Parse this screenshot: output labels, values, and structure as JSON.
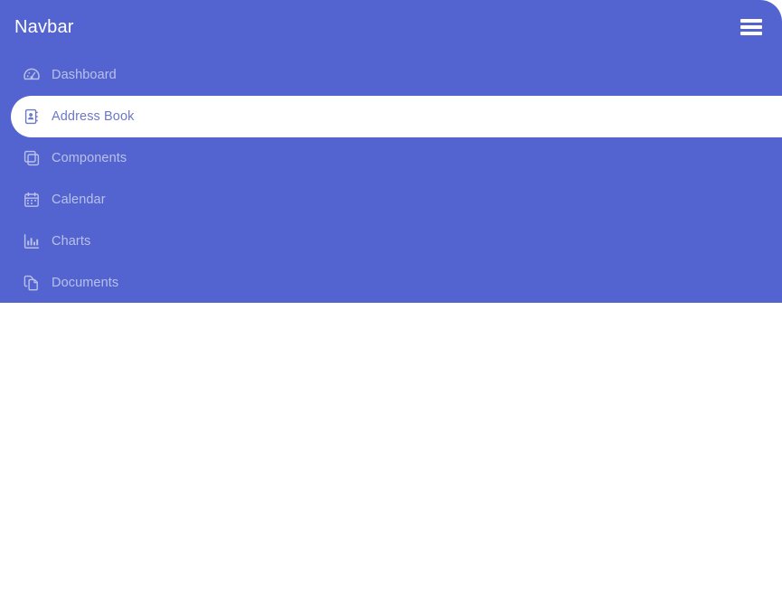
{
  "theme": {
    "panel_bg": "#5364d0",
    "active_bg": "#ffffff",
    "active_text": "#6b78c8",
    "inactive_text": "#b9c1e8",
    "title_text": "#ffffff"
  },
  "header": {
    "title": "Navbar",
    "menu_toggle_icon": "hamburger-icon"
  },
  "sidebar": {
    "items": [
      {
        "label": "Dashboard",
        "icon": "tachometer-icon",
        "active": false
      },
      {
        "label": "Address Book",
        "icon": "address-book-icon",
        "active": true
      },
      {
        "label": "Components",
        "icon": "clone-icon",
        "active": false
      },
      {
        "label": "Calendar",
        "icon": "calendar-icon",
        "active": false
      },
      {
        "label": "Charts",
        "icon": "bar-chart-icon",
        "active": false
      },
      {
        "label": "Documents",
        "icon": "copy-files-icon",
        "active": false
      }
    ]
  }
}
